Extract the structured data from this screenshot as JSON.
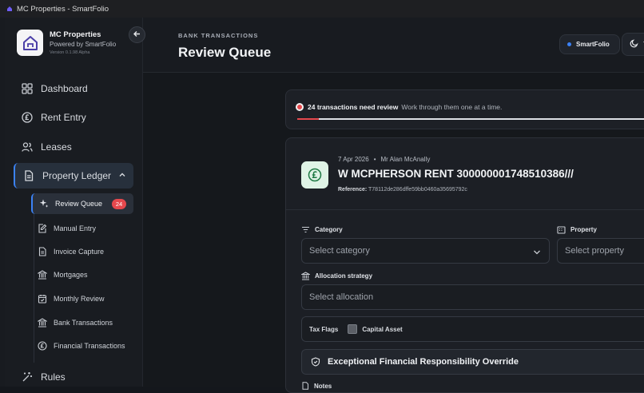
{
  "window": {
    "title": "MC Properties - SmartFolio"
  },
  "brand": {
    "name": "MC Properties",
    "tagline": "Powered by SmartFolio",
    "version": "Version 0.1.98 Alpha"
  },
  "nav": {
    "dashboard": "Dashboard",
    "rent_entry": "Rent Entry",
    "leases": "Leases",
    "property_ledger": "Property Ledger",
    "rules": "Rules"
  },
  "subnav": {
    "review_queue": "Review Queue",
    "review_queue_count": "24",
    "manual_entry": "Manual Entry",
    "invoice_capture": "Invoice Capture",
    "mortgages": "Mortgages",
    "monthly_review": "Monthly Review",
    "bank_transactions": "Bank Transactions",
    "financial_transactions": "Financial Transactions"
  },
  "header": {
    "eyebrow": "BANK TRANSACTIONS",
    "title": "Review Queue",
    "pill": "SmartFolio",
    "theme_label": "T"
  },
  "banner": {
    "count_text": "24 transactions need review",
    "sub_text": "Work through them one at a time.",
    "progress": 0.06
  },
  "transaction": {
    "date": "7 Apr 2026",
    "payee": "Mr Alan McAnally",
    "description": "W MCPHERSON RENT 3000000017485103​86///",
    "reference_label": "Reference:",
    "reference": "T78112de286dffe59bb0460a35695792c"
  },
  "form": {
    "category_label": "Category",
    "category_placeholder": "Select category",
    "property_label": "Property",
    "property_placeholder": "Select property",
    "allocation_label": "Allocation strategy",
    "allocation_placeholder": "Select allocation",
    "tax_flags_label": "Tax Flags",
    "capital_asset_label": "Capital Asset",
    "override_label": "Exceptional Financial Responsibility Override",
    "notes_label": "Notes"
  },
  "colors": {
    "accent": "#3b82f6",
    "badge": "#e5484d",
    "success_bg": "#dff3e6"
  }
}
